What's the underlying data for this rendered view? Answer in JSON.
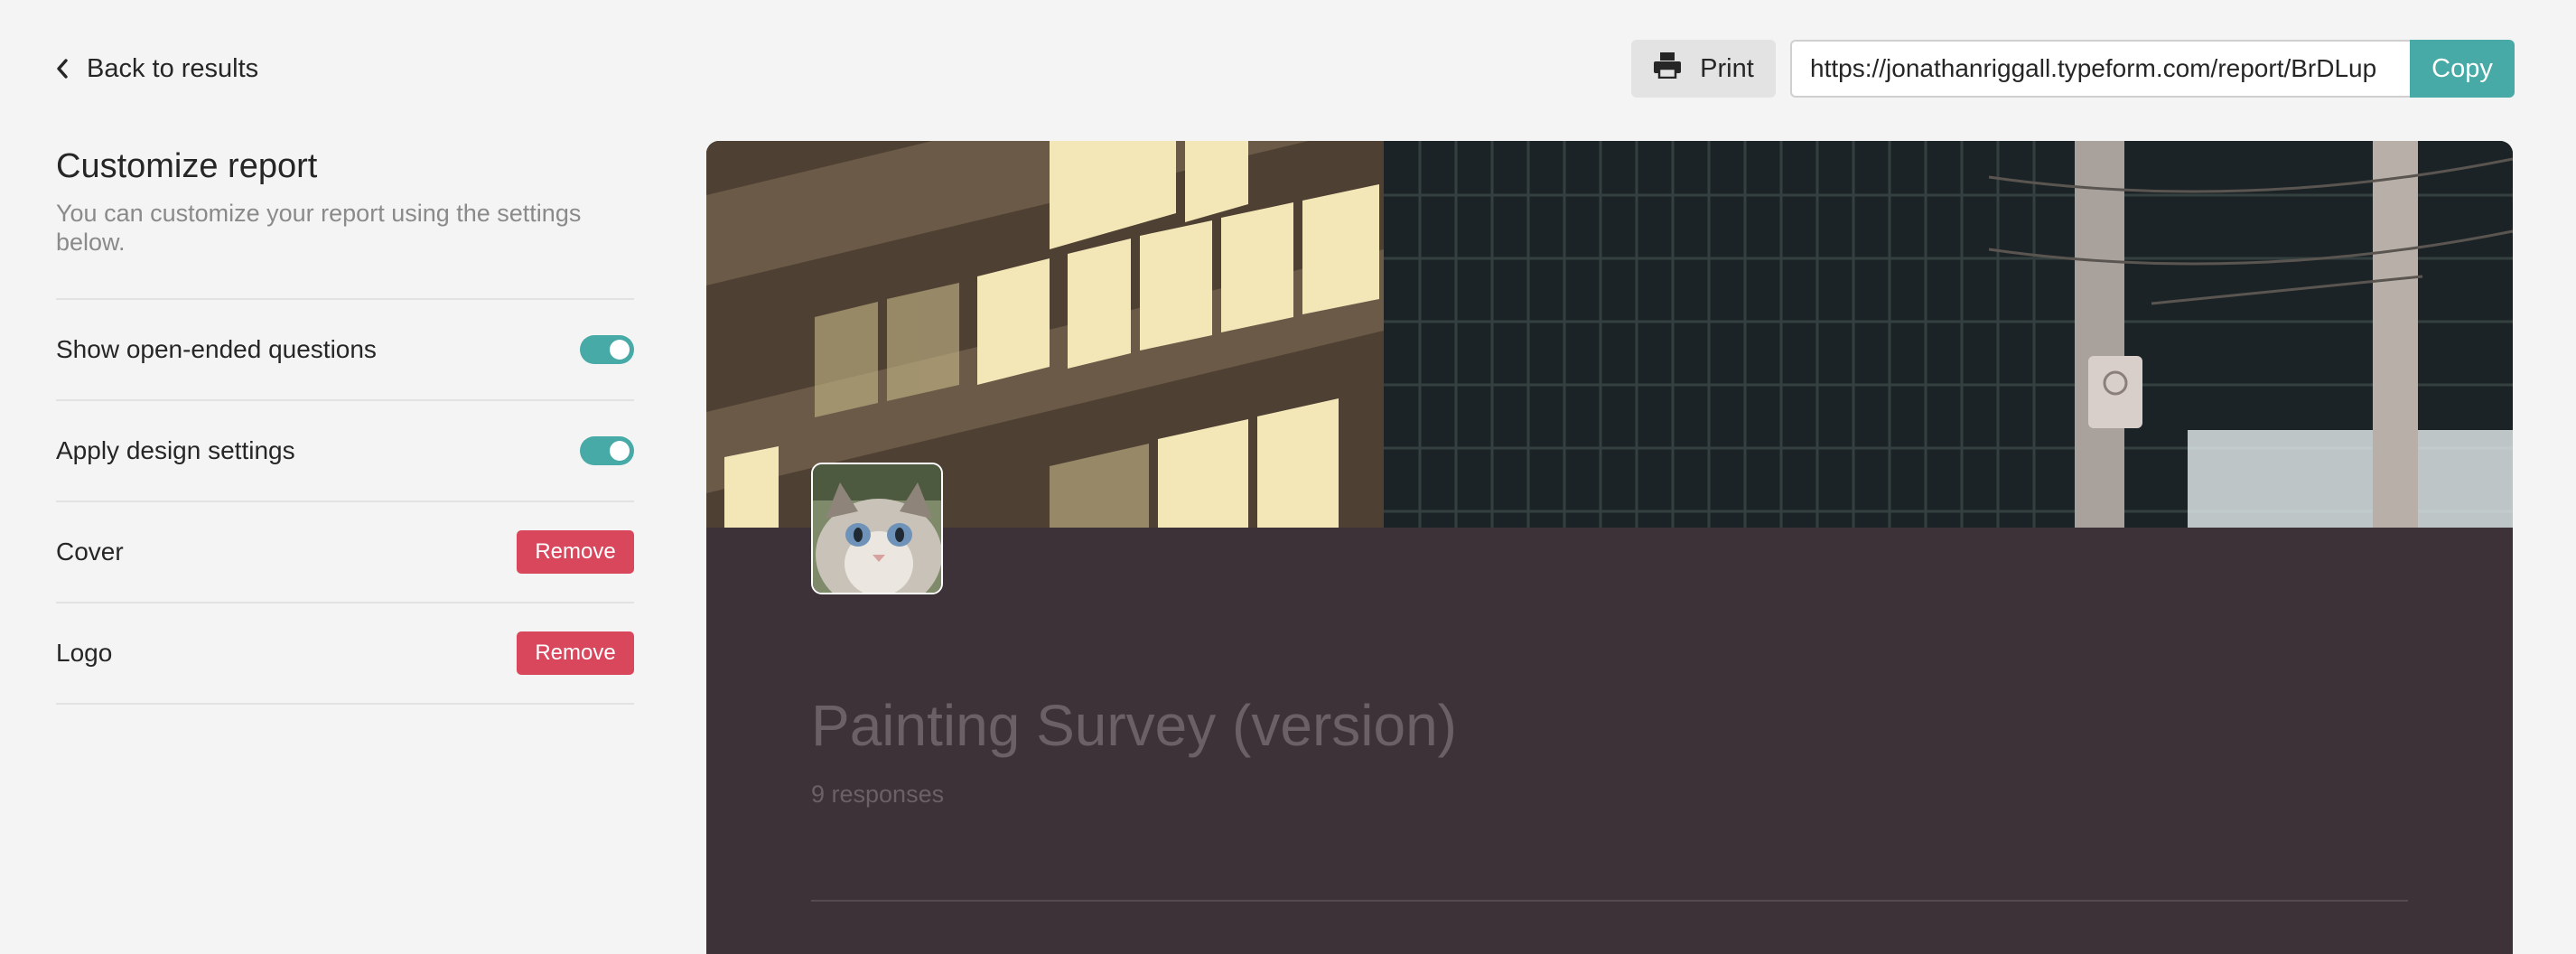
{
  "header": {
    "back_label": "Back to results",
    "print_label": "Print",
    "share_url": "https://jonathanriggall.typeform.com/report/BrDLup",
    "copy_label": "Copy"
  },
  "sidebar": {
    "title": "Customize report",
    "subtitle": "You can customize your report using the settings below.",
    "settings": [
      {
        "label": "Show open-ended questions",
        "control": "toggle",
        "enabled": true
      },
      {
        "label": "Apply design settings",
        "control": "toggle",
        "enabled": true
      },
      {
        "label": "Cover",
        "control": "button",
        "button_label": "Remove"
      },
      {
        "label": "Logo",
        "control": "button",
        "button_label": "Remove"
      }
    ]
  },
  "report": {
    "title": "Painting Survey (version)",
    "responses": "9 responses"
  },
  "icons": {
    "back": "chevron-left-icon",
    "print": "printer-icon"
  },
  "colors": {
    "accent": "#47aaa6",
    "danger": "#d9475c",
    "report_background": "#3c3238"
  }
}
